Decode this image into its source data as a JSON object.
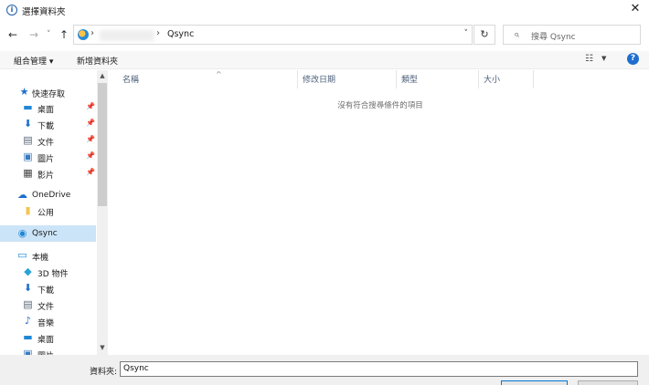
{
  "window": {
    "title": "選擇資料夾",
    "close_glyph": "✕",
    "app_glyph": "i"
  },
  "nav": {
    "back": "←",
    "forward": "→",
    "history": "˅",
    "up": "↑"
  },
  "address": {
    "sep": "›",
    "current": "Qsync",
    "dropdown": "˅",
    "refresh": "↻"
  },
  "search": {
    "placeholder": "搜尋 Qsync",
    "icon": "⌕"
  },
  "toolbar": {
    "organize": "組合管理 ▾",
    "new_folder": "新增資料夾",
    "view_glyph": "☷",
    "view_dd": "▼",
    "help": "?"
  },
  "sidebar": {
    "items": [
      {
        "label": "快速存取",
        "icon": "★",
        "color": "#1f6ecf"
      },
      {
        "label": "桌面",
        "icon": "▬",
        "color": "#1f87d6"
      },
      {
        "label": "下載",
        "icon": "⬇",
        "color": "#1f6ecf"
      },
      {
        "label": "文件",
        "icon": "▤",
        "color": "#5a6a7a"
      },
      {
        "label": "圖片",
        "icon": "▣",
        "color": "#3a7abf"
      },
      {
        "label": "影片",
        "icon": "▦",
        "color": "#444444"
      },
      {
        "label": "OneDrive",
        "icon": "☁",
        "color": "#1f6ecf"
      },
      {
        "label": "公用",
        "icon": "▮",
        "color": "#f3c552"
      },
      {
        "label": "Qsync",
        "icon": "◉",
        "color": "#1f87d6"
      },
      {
        "label": "本機",
        "icon": "▭",
        "color": "#1f87d6"
      },
      {
        "label": "3D 物件",
        "icon": "◆",
        "color": "#27a3d8"
      },
      {
        "label": "下載",
        "icon": "⬇",
        "color": "#1f6ecf"
      },
      {
        "label": "文件",
        "icon": "▤",
        "color": "#5a6a7a"
      },
      {
        "label": "音樂",
        "icon": "♪",
        "color": "#1f6ecf"
      },
      {
        "label": "桌面",
        "icon": "▬",
        "color": "#1f87d6"
      },
      {
        "label": "圖片",
        "icon": "▣",
        "color": "#3a7abf"
      }
    ],
    "pin_glyph": "📌",
    "scroll_up": "▲",
    "scroll_down": "▼"
  },
  "columns": {
    "name": "名稱",
    "modified": "修改日期",
    "type": "類型",
    "size": "大小",
    "sort_glyph": "^"
  },
  "empty_message": "沒有符合搜尋條件的項目",
  "footer": {
    "folder_label": "資料夾:",
    "folder_value": "Qsync"
  }
}
